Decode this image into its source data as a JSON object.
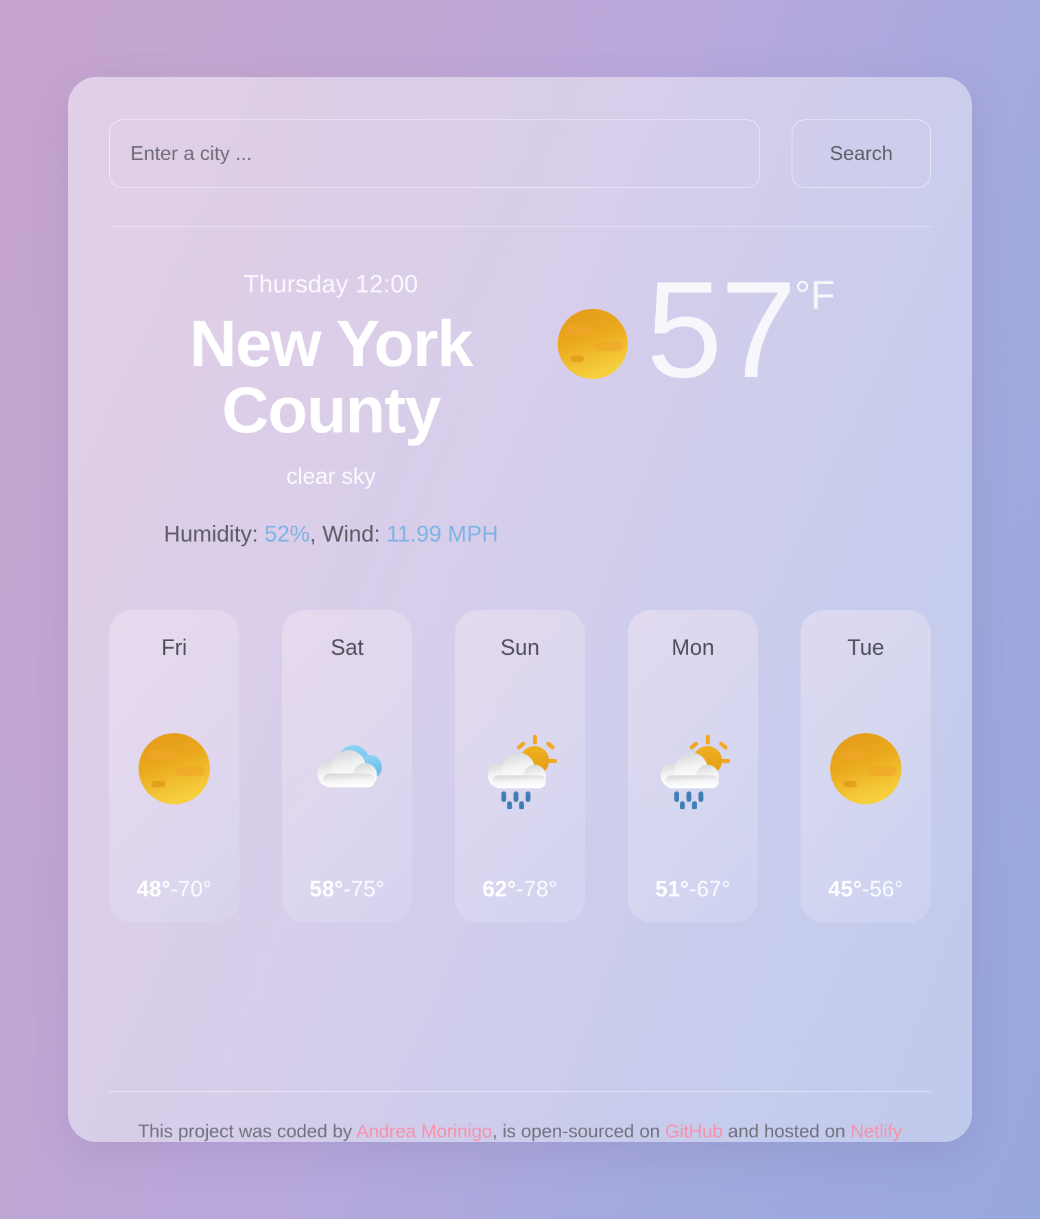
{
  "theme": {
    "bg_from": "#c6a5ce",
    "bg_to": "#97a8de",
    "accent_blue": "#7fb2e5",
    "accent_pink": "#f98fa8",
    "sun_orange": "#e8a317",
    "rain_blue": "#3f7fb5"
  },
  "search": {
    "placeholder": "Enter a city ...",
    "value": "",
    "button_label": "Search"
  },
  "current": {
    "datetime": "Thursday 12:00",
    "city": "New York County",
    "description": "clear sky",
    "icon": "sun-icon",
    "temperature": "57",
    "unit": "°F",
    "humidity_label": "Humidity: ",
    "humidity_value": "52%",
    "separator": ", ",
    "wind_label": "Wind: ",
    "wind_value": "11.99 MPH"
  },
  "forecast": [
    {
      "day": "Fri",
      "icon": "sun-icon",
      "min": "48°",
      "sep": "-",
      "max": "70°"
    },
    {
      "day": "Sat",
      "icon": "cloud-icon",
      "min": "58°",
      "sep": "-",
      "max": "75°"
    },
    {
      "day": "Sun",
      "icon": "sun-rain-icon",
      "min": "62°",
      "sep": "-",
      "max": "78°"
    },
    {
      "day": "Mon",
      "icon": "sun-rain-icon",
      "min": "51°",
      "sep": "-",
      "max": "67°"
    },
    {
      "day": "Tue",
      "icon": "sun-icon",
      "min": "45°",
      "sep": "-",
      "max": "56°"
    }
  ],
  "footer": {
    "part1": "This project was coded by ",
    "author": "Andrea Morinigo",
    "part2": ", is open-sourced on ",
    "source": "GitHub",
    "part3": " and hosted on ",
    "host": "Netlify"
  }
}
